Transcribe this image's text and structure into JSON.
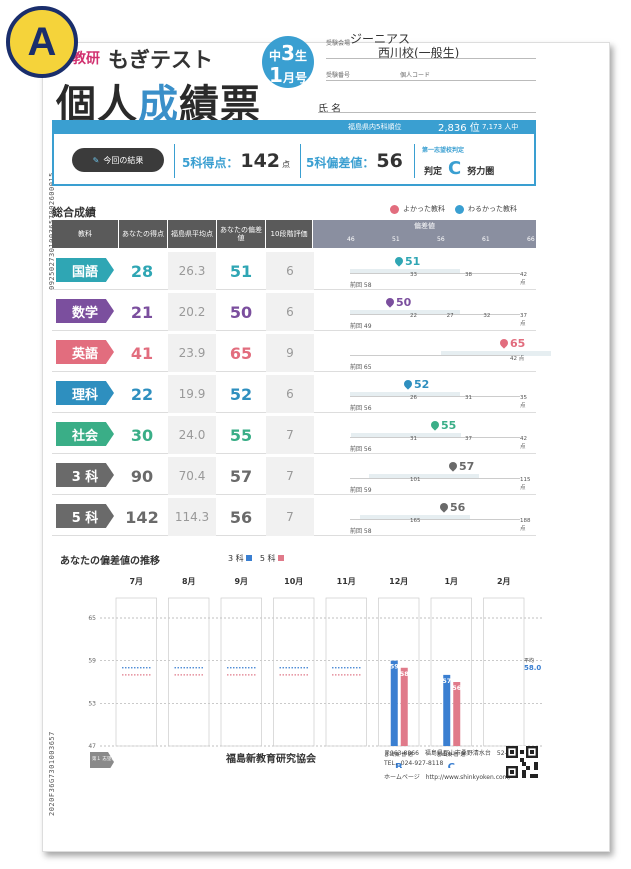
{
  "badge": "A",
  "side_code_top": "0925027301003657002600015",
  "side_code_bottom": "2020F36G7301003657",
  "header": {
    "brand": "新教研",
    "test_name": "もぎテスト",
    "title_pre": "個人",
    "title_accent": "成",
    "title_post": "績票",
    "grade_prefix": "中",
    "grade_num": "3",
    "grade_suffix": "生",
    "month_num": "1",
    "month_unit": "月",
    "month_suffix": "号",
    "venue_label": "受験会場",
    "venue_top": "ジーニアス",
    "venue_name": "西川校(一般生)",
    "exam_no_label": "受験番号",
    "personal_code_label": "個人コード",
    "name_label": "氏 名"
  },
  "summary": {
    "rank_label": "福島県内5科順位",
    "rank_value": "2,836 位",
    "rank_total": "7,173 人中",
    "result_button": "今回の結果",
    "total_label": "5科得点：",
    "total_value": "142",
    "total_unit": "点",
    "dev_label": "5科偏差値：",
    "dev_value": "56",
    "choice_label": "第一志望校判定",
    "judge_label": "判定",
    "judge_value": "C",
    "effort_label": "努力圏"
  },
  "table": {
    "section_title": "総合成績",
    "legend_good": "よかった教科",
    "legend_bad": "わるかった教科",
    "headers": {
      "subject": "教科",
      "your_score": "あなたの得点",
      "pref_avg": "福島県平均点",
      "your_dev": "あなたの偏差値",
      "grade10": "10段階評価",
      "deviation": "偏差値"
    },
    "scale_ticks": [
      "46",
      "51",
      "56",
      "61",
      "66"
    ],
    "rows": [
      {
        "subject": "国語",
        "score": "28",
        "avg": "26.3",
        "dev": "51",
        "grade": "6",
        "prev": "前回 58",
        "marker": "51",
        "t1": "33",
        "t2": "38",
        "t3": "42 点",
        "color": "#2fa6b4"
      },
      {
        "subject": "数学",
        "score": "21",
        "avg": "20.2",
        "dev": "50",
        "grade": "6",
        "prev": "前回 49",
        "marker": "50",
        "t1": "22",
        "t2": "27",
        "t3": "32",
        "t4": "37 点",
        "color": "#7b4f9e"
      },
      {
        "subject": "英語",
        "score": "41",
        "avg": "23.9",
        "dev": "65",
        "grade": "9",
        "prev": "前回 65",
        "marker": "65",
        "t1": "42 点",
        "color": "#e26d7e"
      },
      {
        "subject": "理科",
        "score": "22",
        "avg": "19.9",
        "dev": "52",
        "grade": "6",
        "prev": "前回 56",
        "marker": "52",
        "t1": "26",
        "t2": "31",
        "t3": "35 点",
        "color": "#2e8fbf"
      },
      {
        "subject": "社会",
        "score": "30",
        "avg": "24.0",
        "dev": "55",
        "grade": "7",
        "prev": "前回 56",
        "marker": "55",
        "t1": "31",
        "t2": "37",
        "t3": "42 点",
        "color": "#3aae87"
      },
      {
        "subject": "3 科",
        "score": "90",
        "avg": "70.4",
        "dev": "57",
        "grade": "7",
        "prev": "前回 59",
        "marker": "57",
        "t1": "101",
        "t2": "115 点",
        "color": "#6a6a6a"
      },
      {
        "subject": "5 科",
        "score": "142",
        "avg": "114.3",
        "dev": "56",
        "grade": "7",
        "prev": "前回 58",
        "marker": "56",
        "t1": "165",
        "t2": "188 点",
        "color": "#6a6a6a"
      }
    ]
  },
  "trend": {
    "title": "あなたの偏差値の推移",
    "legend3": "3 科",
    "legend5": "5 科",
    "months": [
      "7月",
      "8月",
      "9月",
      "10月",
      "11月",
      "12月",
      "1月",
      "2月"
    ],
    "y_ticks": [
      "65",
      "59",
      "53",
      "47"
    ],
    "bar_dec_3": "59",
    "bar_dec_5": "58",
    "bar_jan_3": "57",
    "bar_jan_5": "56",
    "avg_label": "平均",
    "avg_3": "58.0",
    "avg_5": "57.0",
    "school_dec": "郡山東 普 通",
    "school_jan": "郡山東 普 通",
    "judge_dec": "B",
    "judge_jan": "C",
    "first_choice": "第１ 志望校 判定"
  },
  "chart_data": {
    "type": "bar",
    "title": "あなたの偏差値の推移",
    "categories": [
      "7月",
      "8月",
      "9月",
      "10月",
      "11月",
      "12月",
      "1月",
      "2月"
    ],
    "series": [
      {
        "name": "3 科",
        "values": [
          null,
          null,
          null,
          null,
          null,
          59,
          57,
          null
        ]
      },
      {
        "name": "5 科",
        "values": [
          null,
          null,
          null,
          null,
          null,
          58,
          56,
          null
        ]
      }
    ],
    "ylim": [
      47,
      65
    ],
    "colors": {
      "3 科": "#3a7fd1",
      "5 科": "#e07a8a"
    }
  },
  "footer": {
    "org": "福島新教育研究協会",
    "postal": "〒963-8866　福島県郡山市桑野清水台　52-4",
    "tel": "TEL．024-927-8118",
    "homepage": "ホームページ　http://www.shinkyoken.com/"
  }
}
